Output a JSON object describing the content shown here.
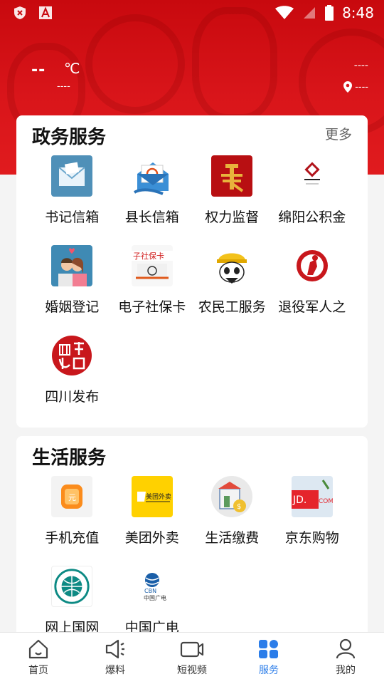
{
  "status_bar": {
    "time": "8:48"
  },
  "weather": {
    "temp": "--",
    "unit": "℃",
    "desc": "----",
    "right_top": "----",
    "location": "----"
  },
  "gov": {
    "title": "政务服务",
    "more": "更多",
    "items": [
      {
        "label": "书记信箱",
        "icon": "mail-envelope-icon"
      },
      {
        "label": "县长信箱",
        "icon": "email-at-icon"
      },
      {
        "label": "权力监督",
        "icon": "power-supervision-icon"
      },
      {
        "label": "绵阳公积金",
        "icon": "housing-fund-icon"
      },
      {
        "label": "婚姻登记",
        "icon": "couple-icon"
      },
      {
        "label": "电子社保卡",
        "icon": "social-security-card-icon"
      },
      {
        "label": "农民工服务",
        "icon": "panda-worker-icon"
      },
      {
        "label": "退役军人之",
        "icon": "veteran-icon"
      },
      {
        "label": "四川发布",
        "icon": "sichuan-seal-icon"
      }
    ]
  },
  "life": {
    "title": "生活服务",
    "items": [
      {
        "label": "手机充值",
        "icon": "phone-recharge-icon"
      },
      {
        "label": "美团外卖",
        "icon": "meituan-icon"
      },
      {
        "label": "生活缴费",
        "icon": "bill-payment-icon"
      },
      {
        "label": "京东购物",
        "icon": "jd-icon"
      },
      {
        "label": "网上国网",
        "icon": "state-grid-icon"
      },
      {
        "label": "中国广电",
        "icon": "china-broadnet-icon"
      }
    ]
  },
  "tabs": [
    {
      "label": "首页",
      "icon": "home-icon"
    },
    {
      "label": "爆料",
      "icon": "megaphone-icon"
    },
    {
      "label": "短视频",
      "icon": "video-icon"
    },
    {
      "label": "服务",
      "icon": "services-grid-icon",
      "active": true
    },
    {
      "label": "我的",
      "icon": "profile-icon"
    }
  ],
  "colors": {
    "brand_red": "#d9151a",
    "active_tab": "#2b7de9"
  }
}
